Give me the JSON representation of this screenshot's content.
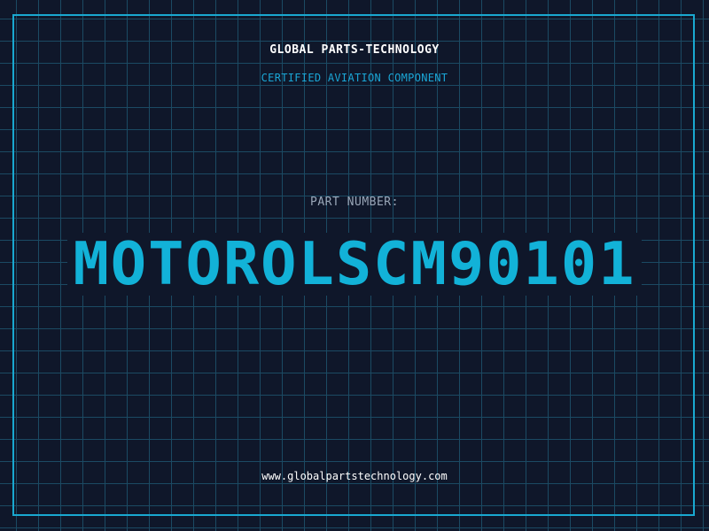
{
  "header": {
    "brand": "GLOBAL PARTS-TECHNOLOGY",
    "tagline": "CERTIFIED AVIATION COMPONENT"
  },
  "part": {
    "label": "PART NUMBER:",
    "number": "MOTOROLSCM90101"
  },
  "footer": {
    "url": "www.globalpartstechnology.com"
  },
  "colors": {
    "background": "#0f172a",
    "grid": "#1b4a63",
    "accent": "#12b2d8",
    "text": "#ffffff",
    "muted": "#9aa7b8"
  }
}
